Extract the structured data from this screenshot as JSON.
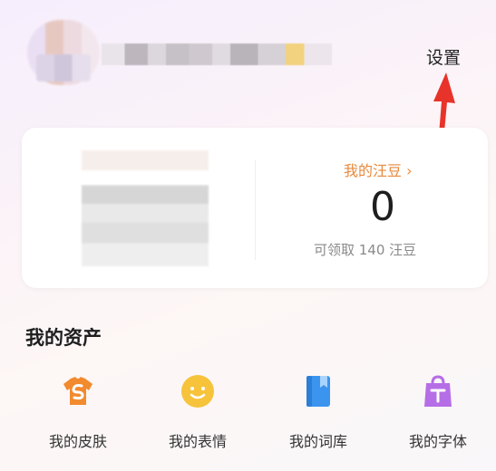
{
  "header": {
    "settings_label": "设置"
  },
  "card": {
    "wangdou_link": "我的汪豆 ›",
    "wangdou_count": "0",
    "claimable_text": "可领取 140 汪豆"
  },
  "assets": {
    "title": "我的资产",
    "items": [
      {
        "label": "我的皮肤",
        "icon": "skin-tshirt-icon",
        "color": "#f28a2e"
      },
      {
        "label": "我的表情",
        "icon": "emoji-smile-icon",
        "color": "#f6c33b"
      },
      {
        "label": "我的词库",
        "icon": "book-icon",
        "color": "#3b95ef"
      },
      {
        "label": "我的字体",
        "icon": "font-bag-icon",
        "color": "#b66ee6"
      }
    ]
  },
  "colors": {
    "accent_orange": "#e8893c",
    "arrow_red": "#e8332a"
  }
}
